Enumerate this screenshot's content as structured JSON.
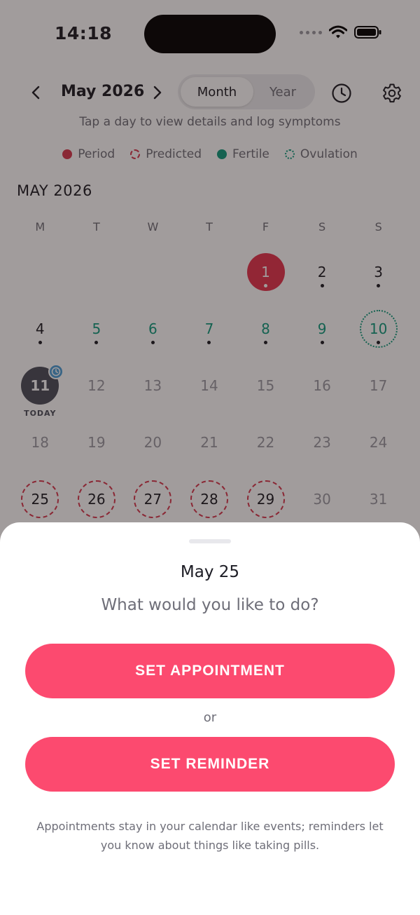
{
  "status_bar": {
    "time": "14:18"
  },
  "header": {
    "month_label": "May 2026",
    "view_toggle": {
      "month": "Month",
      "year": "Year",
      "selected": "Month"
    }
  },
  "hint": "Tap a day to view details and log symptoms",
  "legend": [
    {
      "label": "Period",
      "color": "#d8374e",
      "style": "solid"
    },
    {
      "label": "Predicted",
      "color": "#d8374e",
      "style": "dashed"
    },
    {
      "label": "Fertile",
      "color": "#0f9c7e",
      "style": "solid"
    },
    {
      "label": "Ovulation",
      "color": "#0f9c7e",
      "style": "dotted"
    }
  ],
  "calendar": {
    "heading": "MAY 2026",
    "weekdays": [
      "M",
      "T",
      "W",
      "T",
      "F",
      "S",
      "S"
    ],
    "today_label": "TODAY",
    "weeks": [
      [
        null,
        null,
        null,
        null,
        {
          "day": "1",
          "type": "period",
          "dot": true
        },
        {
          "day": "2",
          "type": "normal",
          "dot": true
        },
        {
          "day": "3",
          "type": "normal",
          "dot": true
        }
      ],
      [
        {
          "day": "4",
          "type": "normal",
          "dot": true
        },
        {
          "day": "5",
          "type": "fertile",
          "dot": true
        },
        {
          "day": "6",
          "type": "fertile",
          "dot": true
        },
        {
          "day": "7",
          "type": "fertile",
          "dot": true
        },
        {
          "day": "8",
          "type": "fertile",
          "dot": true
        },
        {
          "day": "9",
          "type": "fertile",
          "dot": true
        },
        {
          "day": "10",
          "type": "ovulation",
          "dot": true
        }
      ],
      [
        {
          "day": "11",
          "type": "today",
          "dot": false,
          "badge": "clock-icon"
        },
        {
          "day": "12",
          "type": "muted"
        },
        {
          "day": "13",
          "type": "muted"
        },
        {
          "day": "14",
          "type": "muted"
        },
        {
          "day": "15",
          "type": "muted"
        },
        {
          "day": "16",
          "type": "muted"
        },
        {
          "day": "17",
          "type": "muted"
        }
      ],
      [
        {
          "day": "18",
          "type": "muted"
        },
        {
          "day": "19",
          "type": "muted"
        },
        {
          "day": "20",
          "type": "muted"
        },
        {
          "day": "21",
          "type": "muted"
        },
        {
          "day": "22",
          "type": "muted"
        },
        {
          "day": "23",
          "type": "muted"
        },
        {
          "day": "24",
          "type": "muted"
        }
      ],
      [
        {
          "day": "25",
          "type": "predicted"
        },
        {
          "day": "26",
          "type": "predicted"
        },
        {
          "day": "27",
          "type": "predicted"
        },
        {
          "day": "28",
          "type": "predicted"
        },
        {
          "day": "29",
          "type": "predicted"
        },
        {
          "day": "30",
          "type": "muted"
        },
        {
          "day": "31",
          "type": "muted"
        }
      ]
    ]
  },
  "sheet": {
    "date": "May 25",
    "question": "What would you like to do?",
    "appointment_label": "SET APPOINTMENT",
    "or_label": "or",
    "reminder_label": "SET REMINDER",
    "note": "Appointments stay in your calendar like events; reminders let you know about things like taking pills."
  },
  "colors": {
    "accent": "#fc4a6f",
    "period": "#e5344f",
    "fertile": "#0f9c7e",
    "today": "#4a4e5a",
    "badge": "#4b9fd8"
  }
}
